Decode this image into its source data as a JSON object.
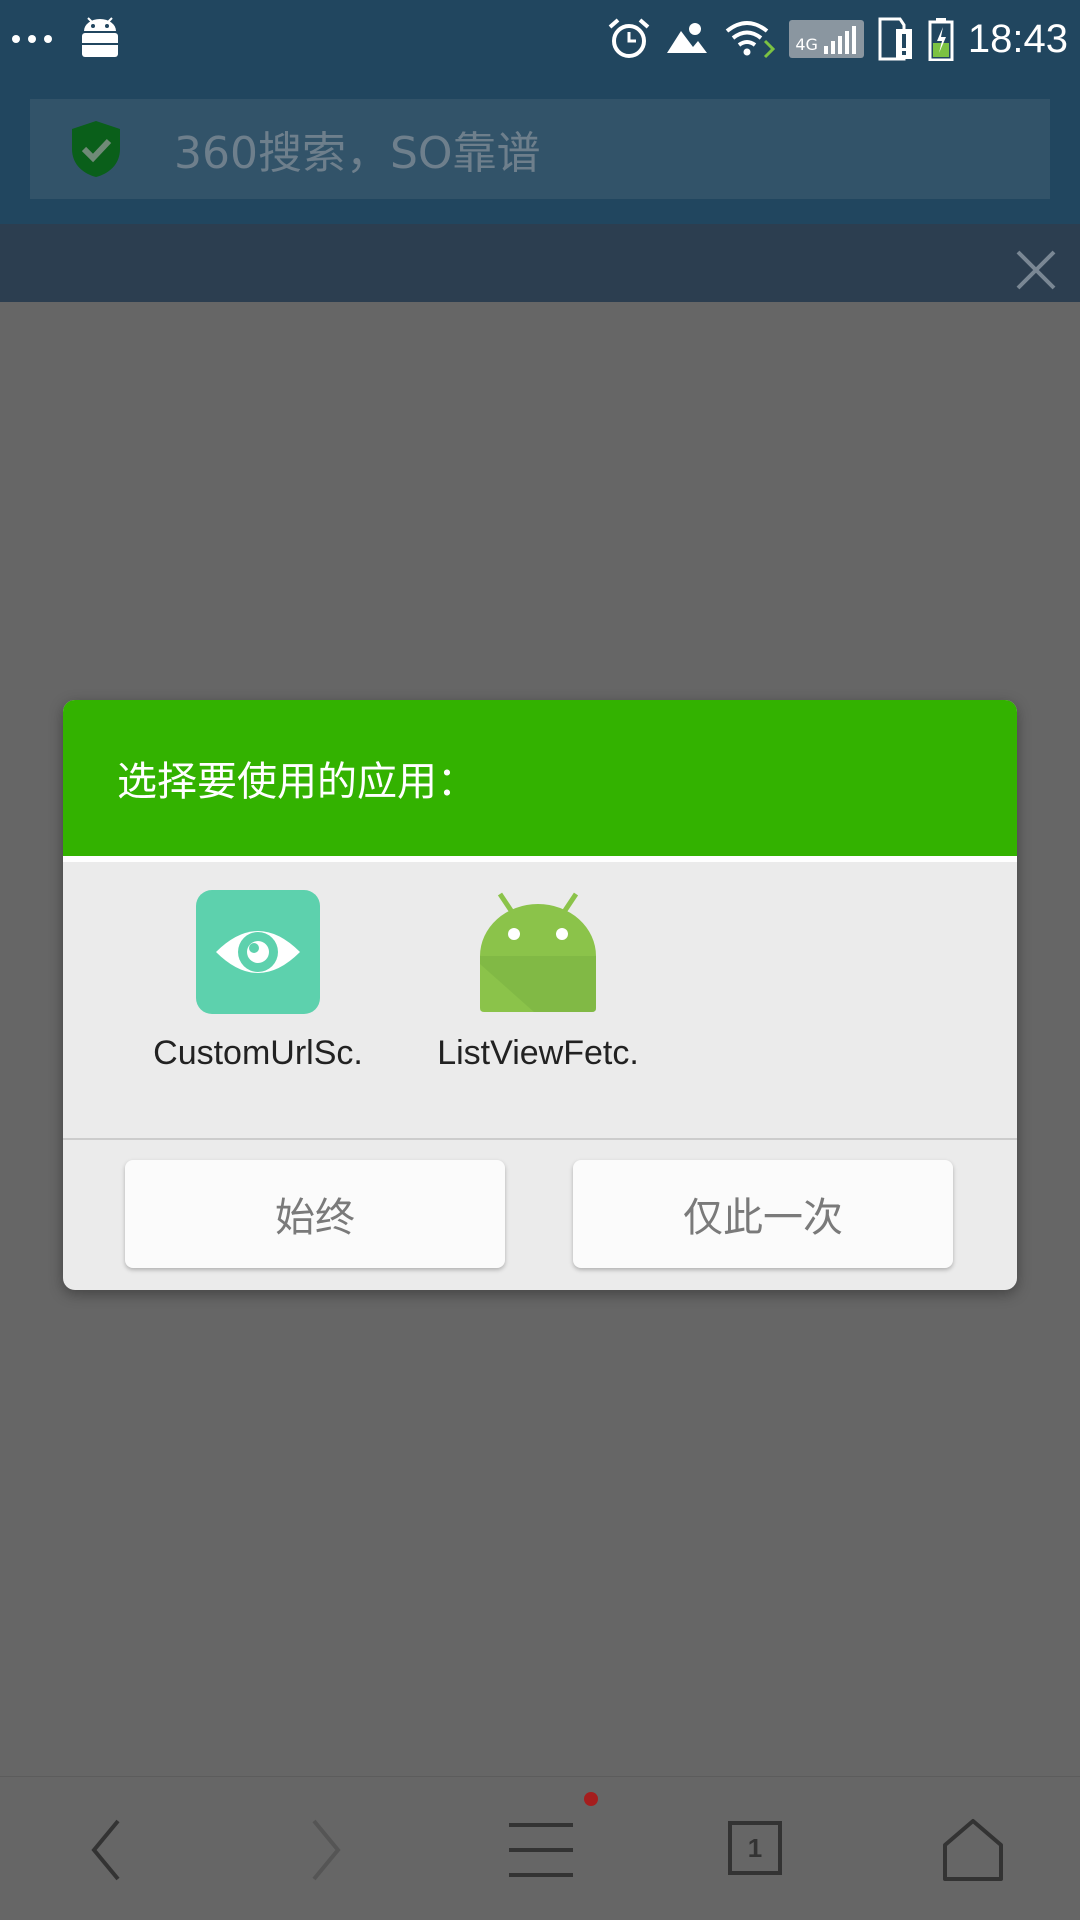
{
  "status_bar": {
    "time": "18:43",
    "network_type": "4G",
    "icons": [
      "more-dots-icon",
      "android-notification-icon",
      "alarm-icon",
      "weather-icon",
      "wifi-icon",
      "signal-icon",
      "sim-alert-icon",
      "battery-charging-icon"
    ]
  },
  "search": {
    "placeholder": "360搜索，SO靠谱",
    "icon": "shield-check-icon"
  },
  "dialog": {
    "title": "选择要使用的应用：",
    "apps": [
      {
        "label": "CustomUrlSc.",
        "icon": "eye-app-icon",
        "color": "#5dd1ad"
      },
      {
        "label": "ListViewFetc.",
        "icon": "android-app-icon",
        "color": "#8bc34a"
      }
    ],
    "buttons": {
      "always": "始终",
      "just_once": "仅此一次"
    },
    "header_color": "#33b200"
  },
  "bottom_nav": {
    "tab_count": "1",
    "items": [
      "back-icon",
      "forward-icon",
      "menu-icon",
      "tabs-icon",
      "home-icon"
    ],
    "notification_dot_color": "#a51e1e"
  }
}
